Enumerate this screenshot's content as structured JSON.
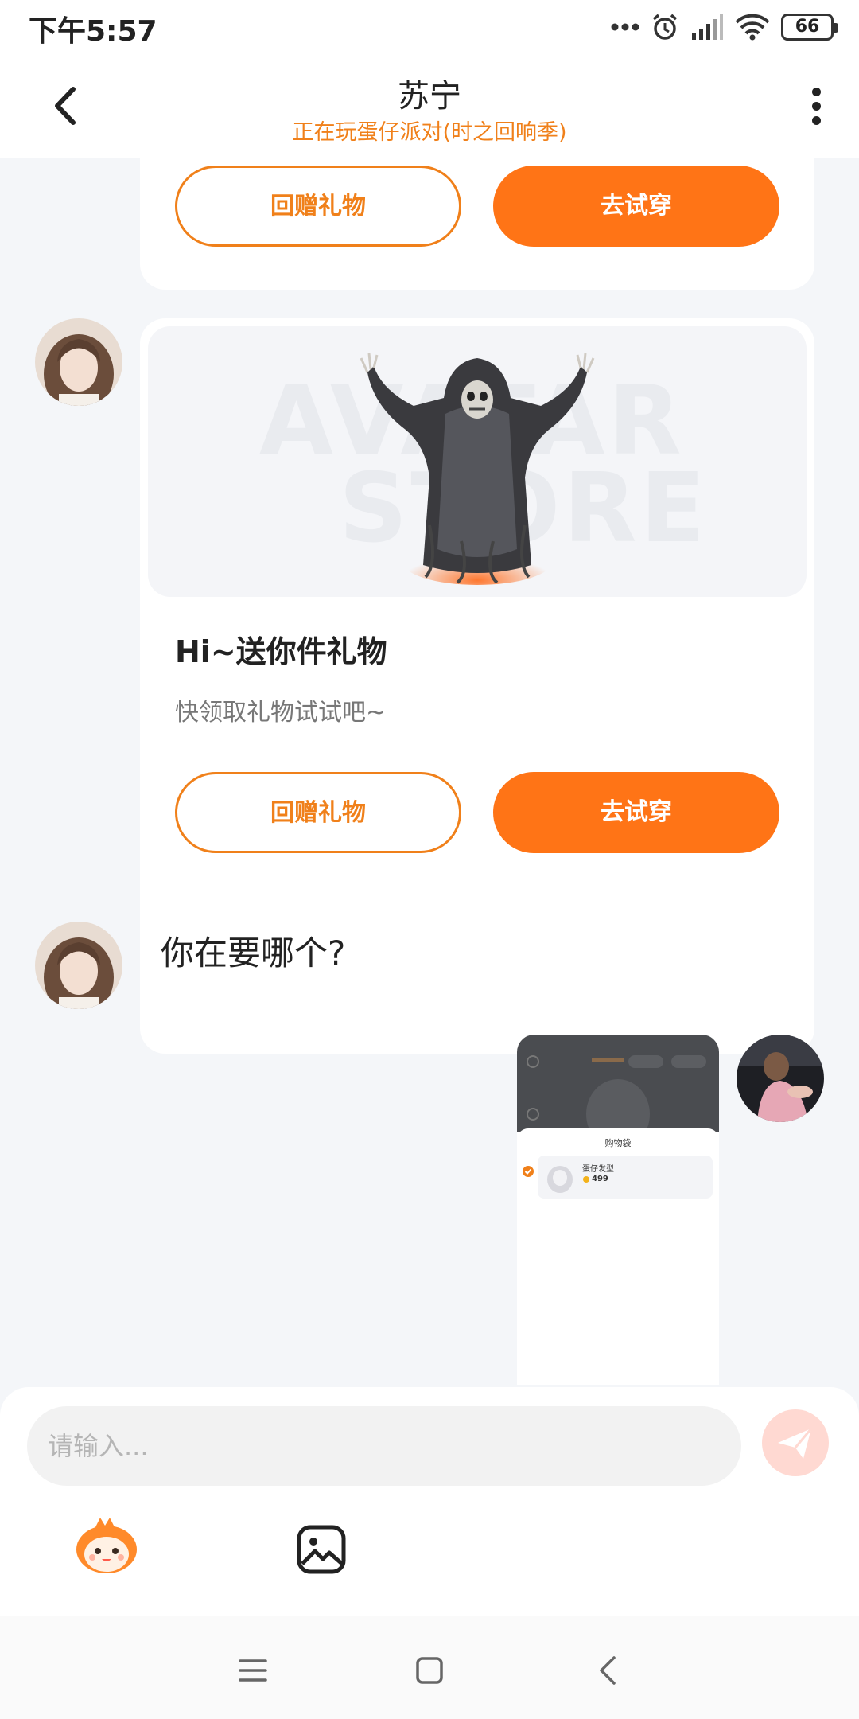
{
  "status_bar": {
    "time": "下午5:57",
    "battery": "66",
    "icons": [
      "more-dots-icon",
      "alarm-icon",
      "signal-icon",
      "wifi-icon",
      "battery-icon"
    ]
  },
  "header": {
    "title": "苏宁",
    "subtitle": "正在玩蛋仔派对(时之回响季)",
    "back_icon": "chevron-left-icon",
    "more_icon": "more-vertical-icon"
  },
  "messages": {
    "card_top": {
      "return_gift_label": "回赠礼物",
      "try_on_label": "去试穿"
    },
    "gift_card": {
      "watermark_line1": "AVATAR",
      "watermark_line2": "STORE",
      "title": "Hi~送你件礼物",
      "description": "快领取礼物试试吧~",
      "return_gift_label": "回赠礼物",
      "try_on_label": "去试穿"
    },
    "text_message": "你在要哪个?",
    "image_message": {
      "sheet_title": "购物袋",
      "item_name": "蛋仔发型",
      "item_price": "499"
    }
  },
  "input": {
    "placeholder": "请输入...",
    "value": ""
  },
  "toolbar": {
    "mascot_icon": "eggy-mascot-icon",
    "image_icon": "image-icon",
    "send_icon": "send-icon"
  },
  "nav_bar": {
    "icons": [
      "menu-icon",
      "home-square-icon",
      "back-icon"
    ]
  },
  "colors": {
    "accent": "#ff7416",
    "accent_text": "#f0801a",
    "background": "#f4f6f9"
  }
}
